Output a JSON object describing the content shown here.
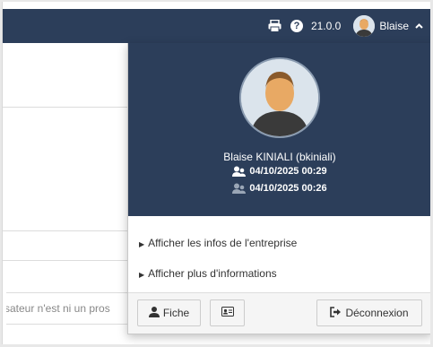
{
  "topbar": {
    "version": "21.0.0",
    "user_short": "Blaise",
    "caret": "^",
    "bg_color": "#2c3e5a"
  },
  "icons": {
    "print": "print-icon",
    "help": "question-circle-icon",
    "help_glyph": "?",
    "caret": "chevron-up-icon",
    "users": "users-icon",
    "user": "user-icon",
    "card": "id-card-icon",
    "logout": "sign-out-icon"
  },
  "background": {
    "truncated_text": "sateur n'est ni un pros"
  },
  "dropdown": {
    "user_fullname": "Blaise KINIALI (bkiniali)",
    "date_line_1": "04/10/2025 00:29",
    "date_line_2": "04/10/2025 00:26",
    "menu": [
      {
        "label": "Afficher les infos de l'entreprise"
      },
      {
        "label": "Afficher plus d'informations"
      }
    ],
    "buttons": {
      "fiche": "Fiche",
      "logout": "Déconnexion"
    }
  }
}
